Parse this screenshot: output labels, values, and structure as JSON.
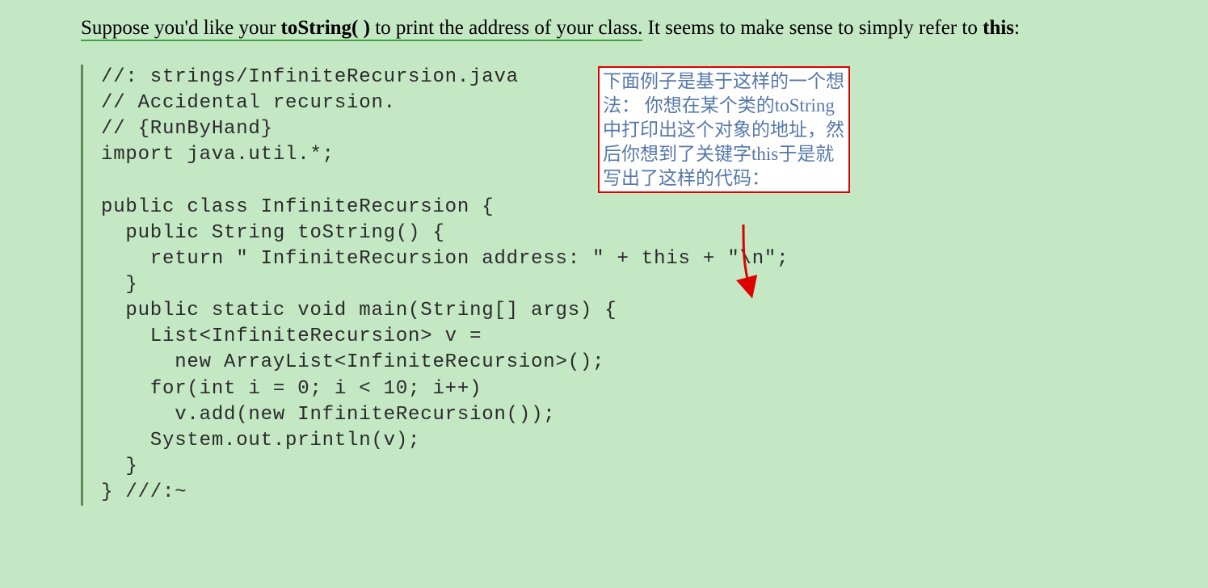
{
  "intro": {
    "underlined_part1": "Suppose you'd like your ",
    "underlined_bold": "toString( )",
    "underlined_part2": " to print the address of your class.",
    "after_underline": " It seems to make sense to simply refer to ",
    "bold_this": "this",
    "colon": ":"
  },
  "code": "//: strings/InfiniteRecursion.java\n// Accidental recursion.\n// {RunByHand}\nimport java.util.*;\n\npublic class InfiniteRecursion {\n  public String toString() {\n    return \" InfiniteRecursion address: \" + this + \"\\n\";\n  }\n  public static void main(String[] args) {\n    List<InfiniteRecursion> v =\n      new ArrayList<InfiniteRecursion>();\n    for(int i = 0; i < 10; i++)\n      v.add(new InfiniteRecursion());\n    System.out.println(v);\n  }\n} ///:~",
  "annotation": "下面例子是基于这样的一个想法：\n你想在某个类的toString中打印出这个对象的地址，然后你想到了关键字this于是就写出了这样的代码："
}
